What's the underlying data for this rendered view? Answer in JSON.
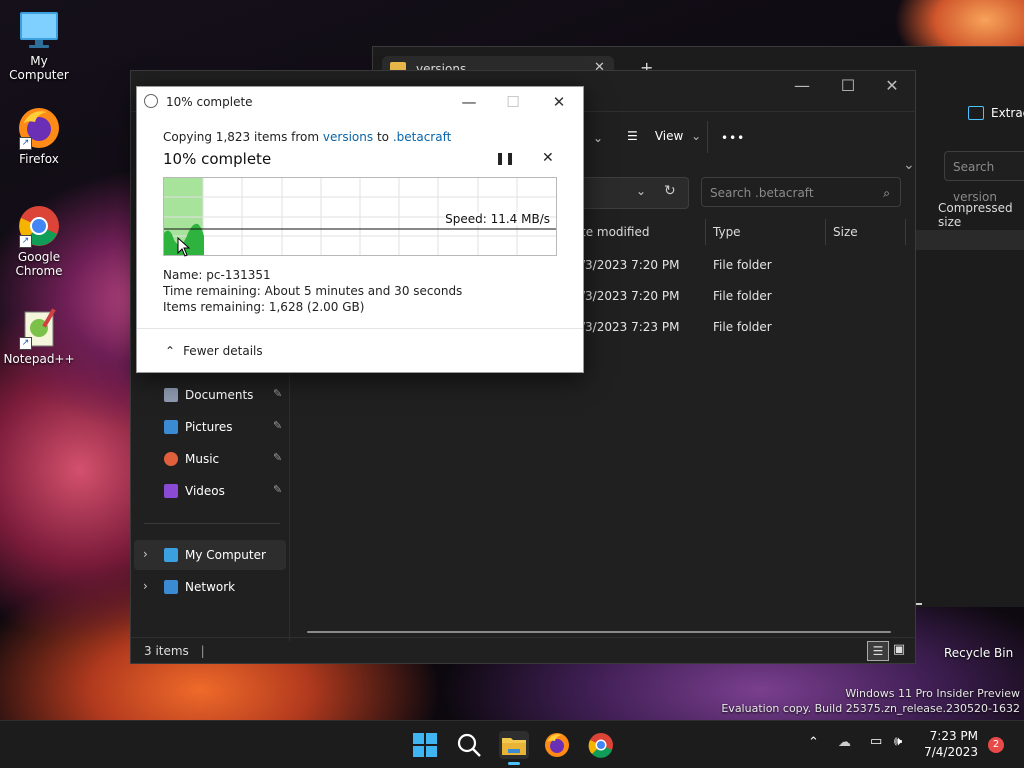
{
  "desktop": {
    "icons": [
      {
        "label": "My Computer",
        "icon": "monitor-icon"
      },
      {
        "label": "Firefox",
        "icon": "firefox-icon"
      },
      {
        "label": "Google Chrome",
        "icon": "chrome-icon"
      },
      {
        "label": "Notepad++",
        "icon": "notepad-plus-plus-icon"
      }
    ],
    "recycle_bin": "Recycle Bin",
    "watermark_line1": "Windows 11 Pro Insider Preview",
    "watermark_line2": "Evaluation copy. Build 25375.zn_release.230520-1632"
  },
  "explorer": {
    "tab_title": "versions",
    "new_tab": "+",
    "extract_label": "Extrac",
    "view_label": "View",
    "more_label": "•••",
    "search_placeholder": "Search .betacraft",
    "search_placeholder_back": "Search version",
    "compressed_size_header": "Compressed size",
    "columns": {
      "date_modified": "te modified",
      "type": "Type",
      "size": "Size"
    },
    "rows": [
      {
        "date": "/3/2023 7:20 PM",
        "type": "File folder"
      },
      {
        "date": "/3/2023 7:20 PM",
        "type": "File folder"
      },
      {
        "date": "/3/2023 7:23 PM",
        "type": "File folder"
      }
    ],
    "nav": {
      "documents": "Documents",
      "pictures": "Pictures",
      "music": "Music",
      "videos": "Videos",
      "my_computer": "My Computer",
      "network": "Network"
    },
    "status_items": "3 items",
    "colors": {
      "bg": "#202020",
      "accent": "#4cc2ff"
    }
  },
  "dialog": {
    "window_title": "10% complete",
    "copy_prefix": "Copying 1,823 items from",
    "source": "versions",
    "to": "to",
    "dest": ".betacraft",
    "heading": "10% complete",
    "speed": "Speed: 11.4 MB/s",
    "name_label": "Name:",
    "name_value": "pc-131351",
    "time_label": "Time remaining:",
    "time_value": "About 5 minutes and 30 seconds",
    "items_label": "Items remaining:",
    "items_value": "1,628 (2.00 GB)",
    "fewer_details": "Fewer details",
    "progress_fraction": 0.1,
    "colors": {
      "link": "#0a64a8",
      "progress_fill": "#a8e39b",
      "graph_fill": "#2fb33f"
    }
  },
  "taskbar": {
    "time": "7:23 PM",
    "date": "7/4/2023",
    "notification_count": "2"
  }
}
